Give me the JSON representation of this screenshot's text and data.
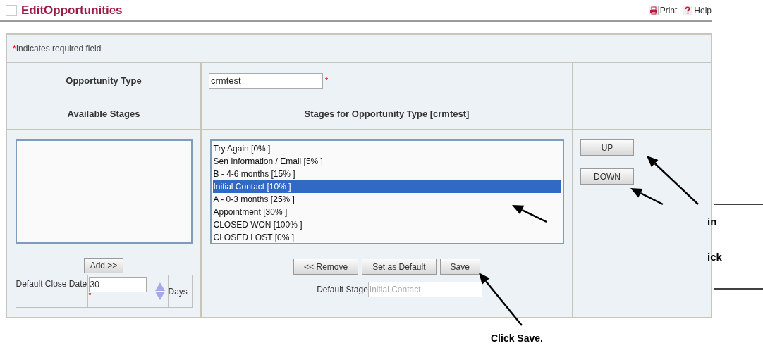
{
  "page": {
    "title": "EditOpportunities",
    "links": [
      {
        "kind": "print",
        "label": "Print"
      },
      {
        "kind": "help",
        "label": "Help"
      }
    ]
  },
  "form": {
    "required_note": {
      "mark": "*",
      "text": "Indicates required field"
    },
    "opportunity_type": {
      "label": "Opportunity Type",
      "value": "crmtest",
      "required_mark": "*"
    },
    "available_stages": {
      "heading": "Available Stages",
      "add_button": "Add >>"
    },
    "default_close_date": {
      "label": "Default Close Date",
      "value": "30",
      "required_mark": "*",
      "unit": "Days"
    },
    "stages": {
      "heading": "Stages for Opportunity Type [crmtest]",
      "items": [
        {
          "label": "Try Again [0% ]",
          "selected": false
        },
        {
          "label": "Sen Information / Email [5% ]",
          "selected": false
        },
        {
          "label": "B - 4-6 months [15% ]",
          "selected": false
        },
        {
          "label": "Initial Contact [10% ]",
          "selected": true
        },
        {
          "label": "A - 0-3 months [25% ]",
          "selected": false
        },
        {
          "label": "Appointment [30% ]",
          "selected": false
        },
        {
          "label": "CLOSED WON [100% ]",
          "selected": false
        },
        {
          "label": "CLOSED LOST [0% ]",
          "selected": false
        }
      ],
      "buttons": [
        "<< Remove",
        "Set as Default",
        "Save"
      ],
      "default_stage": {
        "label": "Default Stage",
        "value": "Initial Contact",
        "disabled": true
      }
    },
    "order_buttons": [
      "UP",
      "DOWN"
    ]
  },
  "annotations": {
    "texts": [
      "in",
      "ick"
    ],
    "caption": "Click Save."
  }
}
